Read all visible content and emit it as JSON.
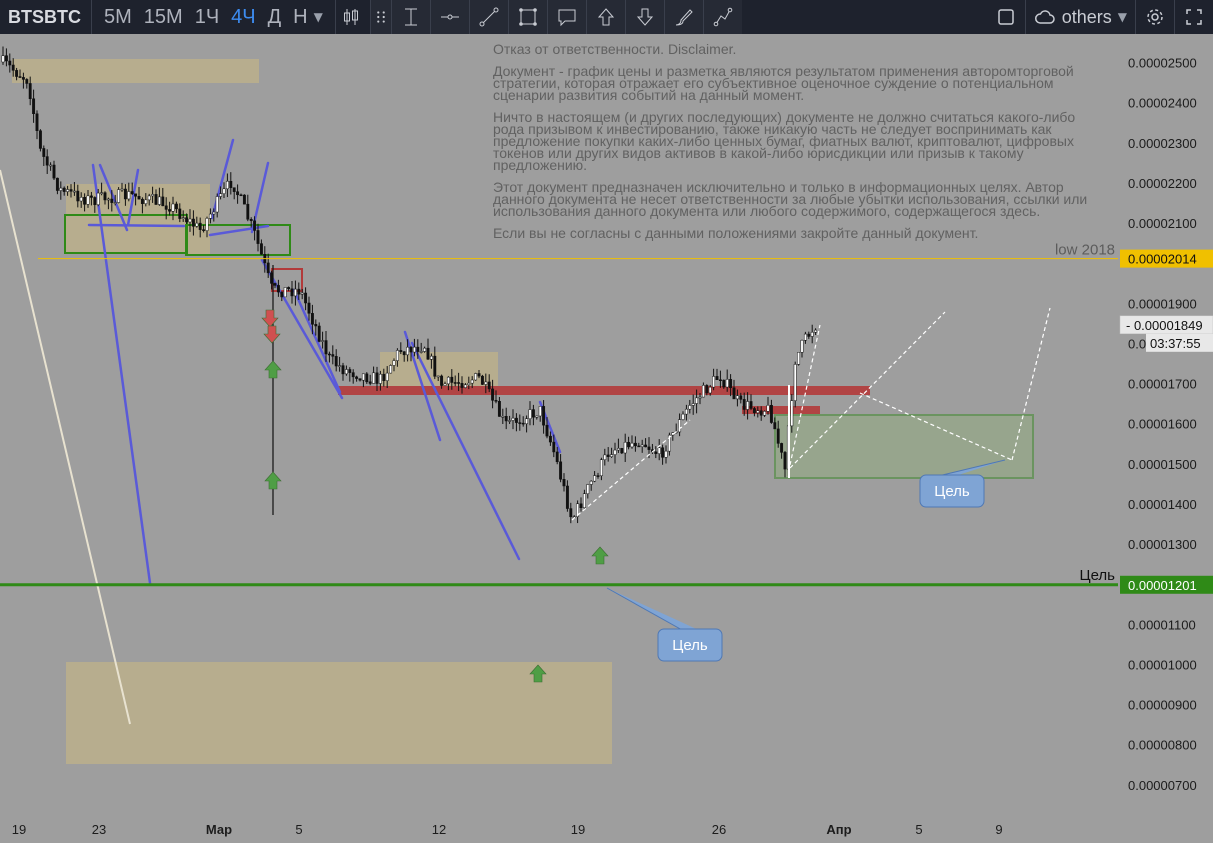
{
  "toolbar": {
    "symbol": "BTSBTC",
    "timeframes": [
      "5M",
      "15M",
      "1Ч",
      "4Ч",
      "Д",
      "Н"
    ],
    "active_timeframe": "4Ч",
    "layout_name": "others",
    "accent_color": "#3d8cf0"
  },
  "disclaimer": {
    "p1": "Отказ от ответственности. Disclaimer.",
    "p2": "Документ - график цены и разметка являются результатом применения авторомторговой стратегии, которая отражает его субъективное оценочное суждение о потенциальном сценарии развития событий на данный момент.",
    "p3": "Ничто в настоящем (и других последующих) документе не должно считаться какого-либо рода призывом к инвестированию, также никакую часть не следует воспринимать как предложение покупки каких-либо ценных бумаг, фиатных валют, криптовалют, цифровых токенов или других видов активов в какой-либо юрисдикции или призыв к такому предложению.",
    "p4": "Этот документ предназначен исключительно и только в информационных целях. Автор данного документа не несет ответственности за любые убытки использования, ссылки или использования данного документа или любого содержимого, содержащегося здесь.",
    "p5": "Если вы не согласны с данными положениями закройте данный документ."
  },
  "chart_data": {
    "type": "candlestick",
    "symbol": "BTSBTC",
    "timeframe": "4Ч",
    "y_axis": {
      "ticks": [
        "0.00002500",
        "0.00002400",
        "0.00002300",
        "0.00002200",
        "0.00002100",
        "0.00001900",
        "0.00001800",
        "0.00001700",
        "0.00001600",
        "0.00001500",
        "0.00001400",
        "0.00001300",
        "0.00001100",
        "0.00001000",
        "0.00000900",
        "0.00000800",
        "0.00000700"
      ],
      "tick_values": [
        2.5e-05,
        2.4e-05,
        2.3e-05,
        2.2e-05,
        2.1e-05,
        1.9e-05,
        1.8e-05,
        1.7e-05,
        1.6e-05,
        1.5e-05,
        1.4e-05,
        1.3e-05,
        1.1e-05,
        1e-05,
        9e-06,
        8e-06,
        7e-06
      ],
      "ylim": [
        6.8e-06,
        2.57e-05
      ]
    },
    "x_axis": {
      "ticks": [
        "19",
        "23",
        "Мар",
        "5",
        "12",
        "19",
        "26",
        "Апр",
        "5",
        "9"
      ],
      "bold_ticks": [
        "Мар",
        "Апр"
      ]
    },
    "price_labels": {
      "low_2018_value": "0.00002014",
      "low_2018_text": "low 2018",
      "low_2018_color": "#f0c000",
      "target_value": "0.00001201",
      "target_text": "Цель",
      "target_color": "#2f8a17",
      "current_price": "0.00001849",
      "countdown": "03:37:55"
    },
    "callouts": [
      {
        "text": "Цель",
        "price": 1.505e-05
      },
      {
        "text": "Цель",
        "price": 1.201e-05
      }
    ],
    "levels": [
      {
        "name": "low 2018",
        "price": 2.014e-05,
        "color": "#f0c000"
      },
      {
        "name": "Цель",
        "price": 1.201e-05,
        "color": "#2f8a17"
      }
    ],
    "colors": {
      "up_candle": "#ffffff",
      "down_candle": "#111111",
      "trendline": "#5a5ad8",
      "zone_fill": "#c2b388",
      "target_zone": "#2f8a17",
      "resistance_zone": "#b23a3a",
      "background": "#9e9e9e"
    }
  }
}
